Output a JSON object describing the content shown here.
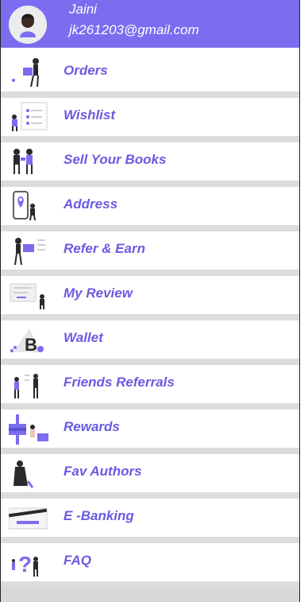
{
  "colors": {
    "accent": "#7B6CF0",
    "label": "#6A5AE0",
    "divider": "#dcdcdc"
  },
  "profile": {
    "name": "Jaini",
    "email": "jk261203@gmail.com"
  },
  "menu": [
    {
      "label": "Orders",
      "icon": "person-with-package-icon"
    },
    {
      "label": "Wishlist",
      "icon": "wishlist-board-icon"
    },
    {
      "label": "Sell Your Books",
      "icon": "people-trade-icon"
    },
    {
      "label": "Address",
      "icon": "location-phone-icon"
    },
    {
      "label": "Refer & Earn",
      "icon": "refer-card-icon"
    },
    {
      "label": "My Review",
      "icon": "review-screen-icon"
    },
    {
      "label": "Wallet",
      "icon": "crypto-wallet-icon"
    },
    {
      "label": "Friends Referrals",
      "icon": "friends-icon"
    },
    {
      "label": "Rewards",
      "icon": "gift-icon"
    },
    {
      "label": "Fav Authors",
      "icon": "author-reading-icon"
    },
    {
      "label": "E -Banking",
      "icon": "bank-card-icon"
    },
    {
      "label": "FAQ",
      "icon": "question-icon"
    }
  ]
}
